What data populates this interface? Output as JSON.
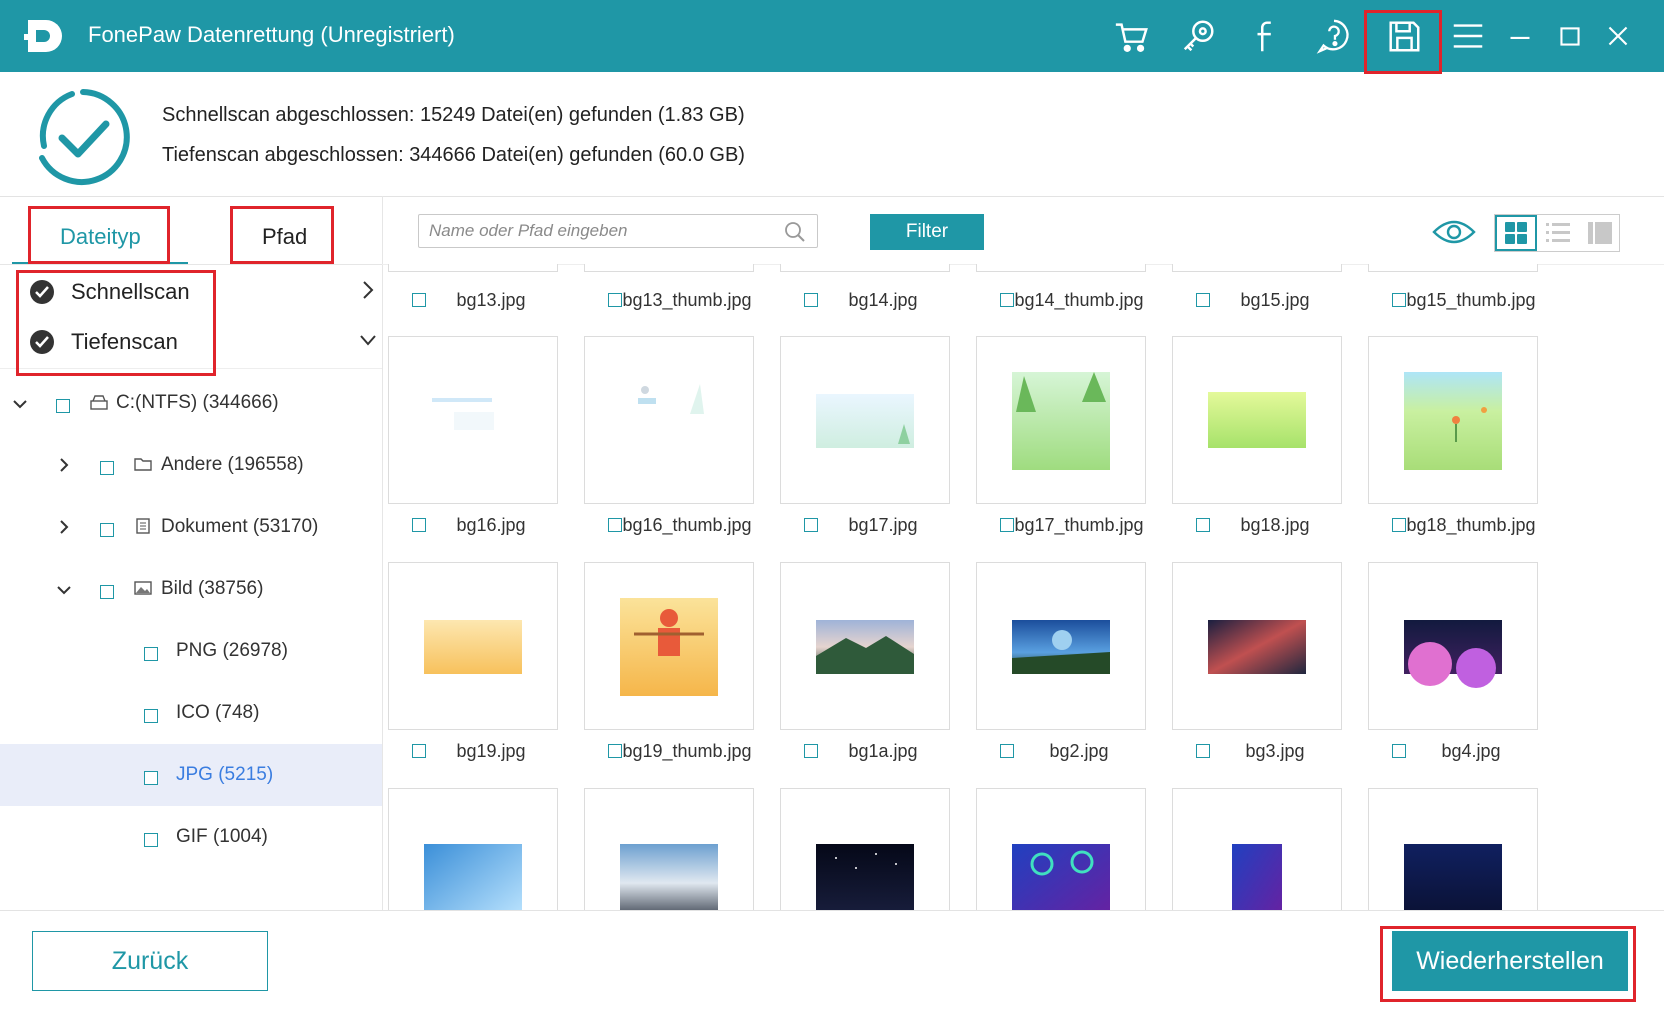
{
  "window": {
    "title": "FonePaw Datenrettung (Unregistriert)"
  },
  "titlebar_icons": [
    "cart-icon",
    "key-icon",
    "facebook-icon",
    "help-icon",
    "save-icon",
    "menu-icon",
    "minimize-icon",
    "maximize-icon",
    "close-icon"
  ],
  "status": {
    "quick": "Schnellscan abgeschlossen: 15249 Datei(en) gefunden (1.83 GB)",
    "deep": "Tiefenscan abgeschlossen: 344666 Datei(en) gefunden (60.0 GB)"
  },
  "tabs": {
    "filetype": "Dateityp",
    "path": "Pfad"
  },
  "scans": {
    "quick": "Schnellscan",
    "deep": "Tiefenscan"
  },
  "tree": {
    "drive": "C:(NTFS) (344666)",
    "other": "Andere (196558)",
    "document": "Dokument (53170)",
    "image": "Bild (38756)",
    "png": "PNG (26978)",
    "ico": "ICO (748)",
    "jpg": "JPG (5215)",
    "gif": "GIF (1004)"
  },
  "toolbar": {
    "search_placeholder": "Name oder Pfad eingeben",
    "filter_label": "Filter"
  },
  "files": {
    "row1": [
      "bg13.jpg",
      "bg13_thumb.jpg",
      "bg14.jpg",
      "bg14_thumb.jpg",
      "bg15.jpg",
      "bg15_thumb.jpg"
    ],
    "row2": [
      "bg16.jpg",
      "bg16_thumb.jpg",
      "bg17.jpg",
      "bg17_thumb.jpg",
      "bg18.jpg",
      "bg18_thumb.jpg"
    ],
    "row3": [
      "bg19.jpg",
      "bg19_thumb.jpg",
      "bg1a.jpg",
      "bg2.jpg",
      "bg3.jpg",
      "bg4.jpg"
    ]
  },
  "footer": {
    "back_label": "Zurück",
    "restore_label": "Wiederherstellen"
  },
  "colors": {
    "accent": "#1f97a6",
    "highlight": "#e0242b",
    "selected_row": "#e9edf9",
    "selected_text": "#3a7de0"
  }
}
